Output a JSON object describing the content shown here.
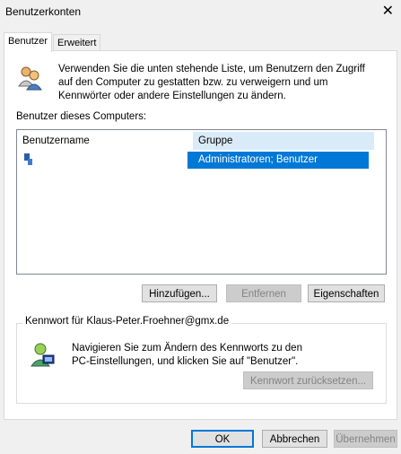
{
  "window": {
    "title": "Benutzerkonten",
    "close_glyph": "✕"
  },
  "tabs": [
    {
      "label": "Benutzer",
      "active": true
    },
    {
      "label": "Erweitert",
      "active": false
    }
  ],
  "intro": {
    "line1": "Verwenden Sie die unten stehende Liste, um Benutzern den Zugriff",
    "line2": "auf den Computer zu gestatten bzw. zu verweigern und um",
    "line3": "Kennwörter oder andere Einstellungen zu ändern."
  },
  "users_section_label": "Benutzer dieses Computers:",
  "user_list": {
    "columns": [
      "Benutzername",
      "Gruppe"
    ],
    "rows": [
      {
        "username": "",
        "group": "Administratoren; Benutzer",
        "selected": true
      }
    ]
  },
  "user_buttons": {
    "add": "Hinzufügen...",
    "remove": "Entfernen",
    "properties": "Eigenschaften"
  },
  "password_group": {
    "label": "Kennwort für Klaus-Peter.Froehner@gmx.de",
    "line1": "Navigieren Sie zum Ändern des Kennworts zu den",
    "line2": "PC-Einstellungen, und klicken Sie auf \"Benutzer\".",
    "reset_button": "Kennwort zurücksetzen..."
  },
  "dialog_buttons": {
    "ok": "OK",
    "cancel": "Abbrechen",
    "apply": "Übernehmen"
  },
  "colors": {
    "selection": "#0078d7",
    "header_highlight": "#d9ebf9",
    "accent": "#0078d7"
  }
}
